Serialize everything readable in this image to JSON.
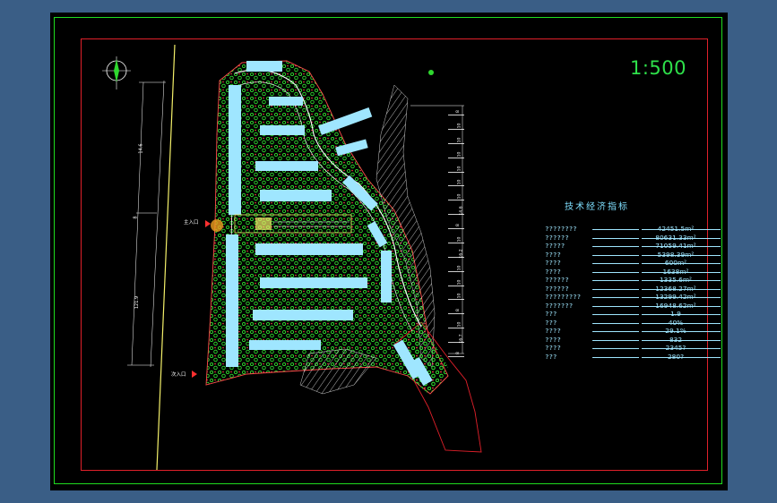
{
  "drawing": {
    "scale_label": "1:500",
    "gate_main": "主入口",
    "gate_second": "次入口",
    "road_dims": [
      "14.6",
      "8",
      "121.9"
    ],
    "right_dims": [
      "8",
      "10",
      "10",
      "10",
      "10",
      "10",
      "10",
      "14.6",
      "8",
      "10",
      "16.2",
      "10",
      "10",
      "10",
      "8",
      "10",
      "16.7",
      "8"
    ]
  },
  "table": {
    "title": "技术经济指标",
    "rows": [
      {
        "label": "????????",
        "value": "42451.5m²"
      },
      {
        "label": "??????",
        "value": "80631.33m²"
      },
      {
        "label": "?????",
        "value": "71059.41m²"
      },
      {
        "label": "????",
        "value": "5398.39m²"
      },
      {
        "label": "????",
        "value": "600m²"
      },
      {
        "label": "????",
        "value": "1638m²"
      },
      {
        "label": "??????",
        "value": "1335.6m²"
      },
      {
        "label": "??????",
        "value": "12368.27m²"
      },
      {
        "label": "?????????",
        "value": "13299.42m²"
      },
      {
        "label": "???????",
        "value": "16948.62m²"
      },
      {
        "label": "???",
        "value": "1.9"
      },
      {
        "label": "???",
        "value": "40%"
      },
      {
        "label": "????",
        "value": "29.1%"
      },
      {
        "label": "????",
        "value": "832"
      },
      {
        "label": "????",
        "value": "2345?"
      },
      {
        "label": "???",
        "value": "280?"
      }
    ]
  },
  "colors": {
    "background": "#000000",
    "outer_frame": "#1fdc1f",
    "inner_frame": "#e0202a",
    "building": "#9fe6ff",
    "tree": "#2fd82f",
    "text": "#9fe6ff"
  }
}
